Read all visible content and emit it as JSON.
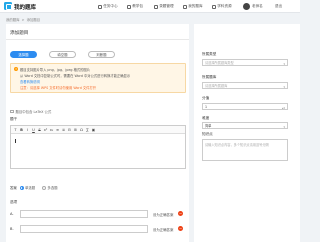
{
  "app": {
    "title": "我的题库"
  },
  "nav": [
    {
      "label": "任务中心",
      "icon": "task-icon"
    },
    {
      "label": "教学包",
      "icon": "package-icon"
    },
    {
      "label": "录题管理",
      "icon": "edit-icon"
    },
    {
      "label": "我的题库",
      "icon": "library-icon"
    },
    {
      "label": "学科资源",
      "icon": "book-icon"
    }
  ],
  "user": {
    "name": "老师名",
    "link": "退出"
  },
  "breadcrumb": [
    "我的题库",
    ">",
    "添加题目"
  ],
  "page": {
    "title": "添加题目"
  },
  "question_types": [
    {
      "label": "选择题",
      "active": true
    },
    {
      "label": "填空题",
      "active": false
    },
    {
      "label": "判断题",
      "active": false
    }
  ],
  "notice": {
    "line1": "题目支持图片导入 png、jpg、jpeg 格式的图片",
    "line2": "从 Word 文档中复制公式时，需要在 Word 中对公式进行转换才能正确显示",
    "line3": "查看转换说明",
    "line4": "注意：请选择 WPS 文件时请勿使用 Word 文件打开"
  },
  "latex_checkbox": {
    "label": "题目中包含 LaTeX 公式"
  },
  "stem": {
    "label": "题干"
  },
  "toolbar": [
    "T",
    "B",
    "I",
    "U",
    "S",
    "x²",
    "x₂",
    "≡",
    "≣",
    "⊟",
    "⊞",
    "Ω",
    "∑",
    "▣"
  ],
  "answer": {
    "label": "答案",
    "options": [
      {
        "label": "单选题",
        "checked": true
      },
      {
        "label": "多选题",
        "checked": false
      }
    ]
  },
  "options_section": {
    "label": "选项",
    "items": [
      {
        "letter": "A.",
        "action": "设为正确答案"
      },
      {
        "letter": "B.",
        "action": "设为正确答案"
      }
    ]
  },
  "side": {
    "category": {
      "label": "所属类型",
      "placeholder": "请选择所属题库类型"
    },
    "knowledge": {
      "label": "所属题库",
      "placeholder": "请选择所属题库"
    },
    "score": {
      "label": "分值",
      "value": "1"
    },
    "difficulty": {
      "label": "难度",
      "value": "简单"
    },
    "keypoint": {
      "label": "知识点",
      "placeholder": "请输入知识点内容，多个知识点请用逗号分隔"
    }
  }
}
